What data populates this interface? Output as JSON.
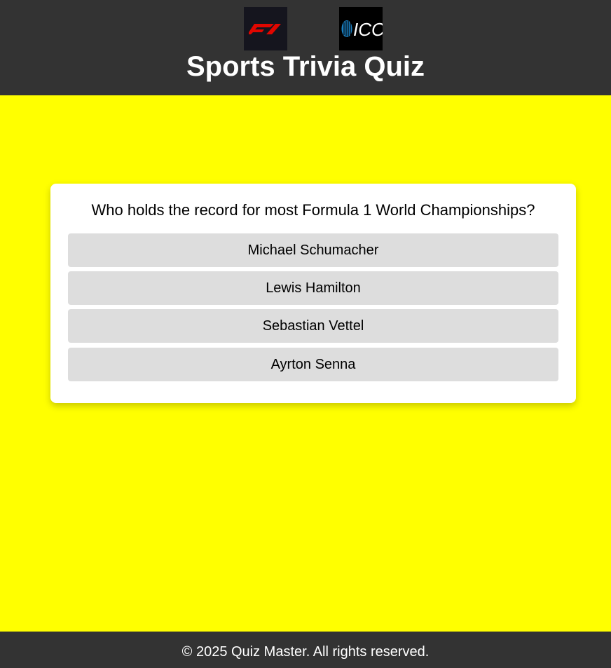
{
  "header": {
    "logos": [
      {
        "icon": "f1-logo-icon"
      },
      {
        "icon": "icc-logo-icon",
        "text": "ICC"
      }
    ],
    "title": "Sports Trivia Quiz"
  },
  "quiz": {
    "question": "Who holds the record for most Formula 1 World Championships?",
    "answers": [
      "Michael Schumacher",
      "Lewis Hamilton",
      "Sebastian Vettel",
      "Ayrton Senna"
    ]
  },
  "footer": {
    "text": "© 2025 Quiz Master. All rights reserved."
  },
  "colors": {
    "page_background": "#ffff00",
    "header_background": "#333333",
    "card_background": "#ffffff",
    "answer_background": "#dddddd",
    "f1_red": "#e10600"
  }
}
